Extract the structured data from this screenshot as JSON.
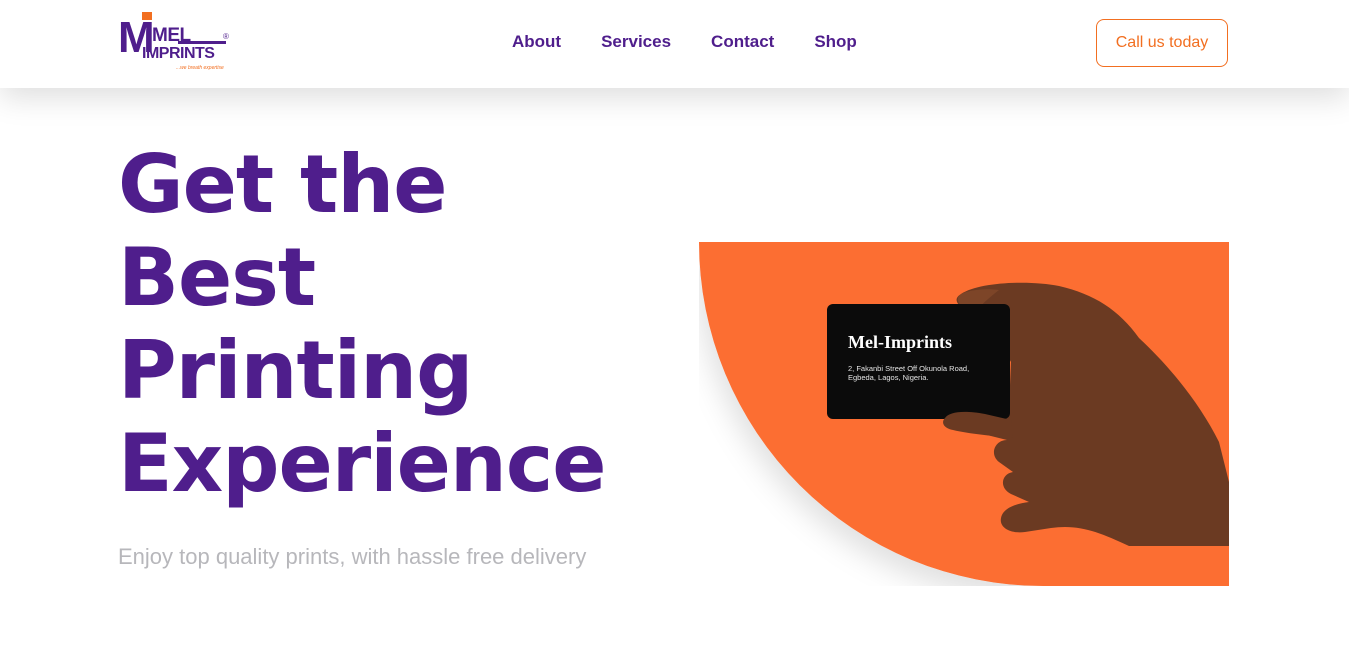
{
  "brand": {
    "logo_mark": "M",
    "logo_top": "MEL",
    "logo_bottom": "IMPRINTS",
    "logo_registered": "®",
    "logo_tagline": "...we breath expertise",
    "primary_color": "#4f1e8c",
    "accent_color": "#f26f21"
  },
  "nav": {
    "items": [
      {
        "label": "About"
      },
      {
        "label": "Services"
      },
      {
        "label": "Contact"
      },
      {
        "label": "Shop"
      }
    ],
    "cta_label": "Call us today"
  },
  "hero": {
    "title_lines": [
      "Get the",
      "Best",
      "Printing",
      "Experience"
    ],
    "subtitle": "Enjoy top quality prints, with hassle free delivery",
    "art_color": "#fc6e32",
    "card": {
      "name": "Mel-Imprints",
      "address": "2, Fakanbi Street Off Okunola Road, Egbeda, Lagos, Nigeria."
    }
  }
}
